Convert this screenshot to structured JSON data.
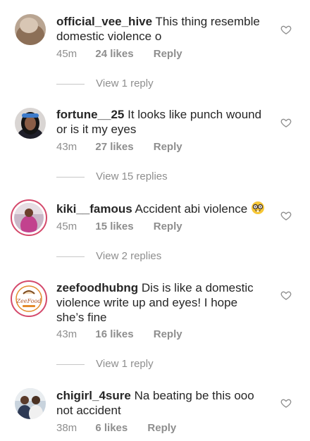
{
  "comments": [
    {
      "username": "official_vee_hive",
      "text": "This thing resemble domestic violence o",
      "time": "45m",
      "likes": "24 likes",
      "reply": "Reply",
      "view_replies": "View 1 reply"
    },
    {
      "username": "fortune__25",
      "text": "It looks like punch wound or is it my eyes",
      "time": "43m",
      "likes": "27 likes",
      "reply": "Reply",
      "view_replies": "View 15 replies"
    },
    {
      "username": "kiki__famous",
      "text": "Accident abi violence",
      "emoji": "nerd-face-emoji",
      "time": "45m",
      "likes": "15 likes",
      "reply": "Reply",
      "view_replies": "View 2 replies"
    },
    {
      "username": "zeefoodhubng",
      "text": "Dis is like a domestic violence write up and eyes! I hope she’s fine",
      "time": "43m",
      "likes": "16 likes",
      "reply": "Reply",
      "view_replies": "View 1 reply",
      "avatar_logo_text": "ZeeFood"
    },
    {
      "username": "chigirl_4sure",
      "text": "Na beating be this ooo not accident",
      "time": "38m",
      "likes": "6 likes",
      "reply": "Reply"
    }
  ],
  "icons": {
    "like": "heart-outline-icon"
  },
  "colors": {
    "meta_gray": "#8e8e8e",
    "story_ring": "#d4496b",
    "text": "#262626"
  }
}
